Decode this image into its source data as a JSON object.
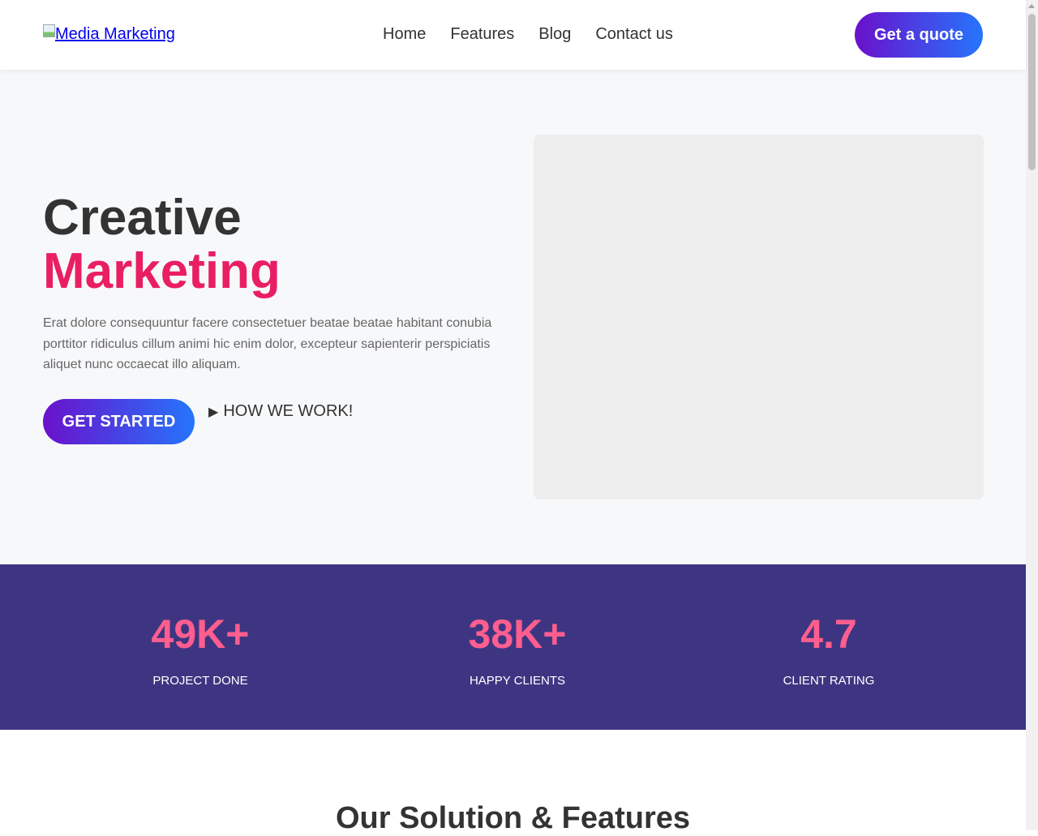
{
  "header": {
    "logo_text": "Media Marketing",
    "nav": [
      "Home",
      "Features",
      "Blog",
      "Contact us"
    ],
    "quote_button": "Get a quote"
  },
  "hero": {
    "title_line1": "Creative",
    "title_line2": "Marketing",
    "description": "Erat dolore consequuntur facere consectetuer beatae beatae habitant conubia porttitor ridiculus cillum animi hic enim dolor, excepteur sapienterir perspiciatis aliquet nunc occaecat illo aliquam.",
    "start_button": "GET STARTED",
    "how_link": "HOW WE WORK!"
  },
  "stats": [
    {
      "value": "49K+",
      "label": "PROJECT DONE"
    },
    {
      "value": "38K+",
      "label": "HAPPY CLIENTS"
    },
    {
      "value": "4.7",
      "label": "CLIENT RATING"
    }
  ],
  "features": {
    "title": "Our Solution & Features"
  },
  "colors": {
    "accent_pink": "#e91e63",
    "stat_pink": "#ff5e8e",
    "stats_bg": "#3e3582",
    "gradient_start": "#6a11cb",
    "gradient_end": "#2575fc"
  },
  "icons": {
    "play": "play-icon",
    "broken_image": "broken-image-icon"
  }
}
